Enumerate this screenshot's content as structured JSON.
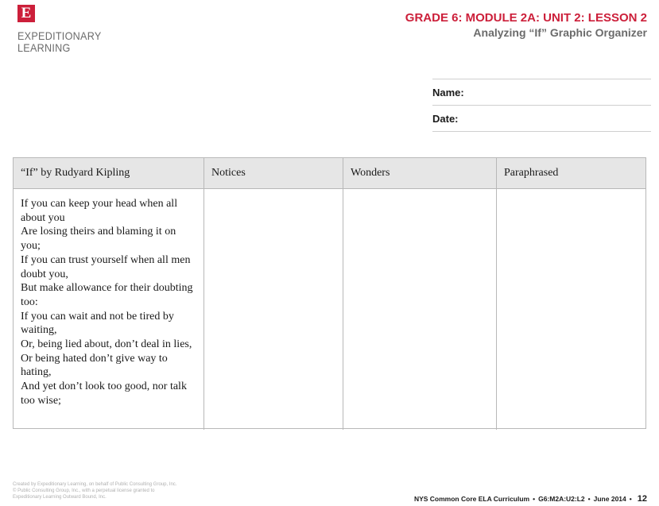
{
  "logo": {
    "mark": "E",
    "line1": "EXPEDITIONARY",
    "line2": "LEARNING"
  },
  "header": {
    "title": "GRADE 6: MODULE 2A: UNIT 2: LESSON 2",
    "subtitle": "Analyzing “If” Graphic Organizer"
  },
  "form": {
    "name_label": "Name:",
    "date_label": "Date:"
  },
  "table": {
    "headers": [
      "“If” by Rudyard Kipling",
      "Notices",
      "Wonders",
      "Paraphrased"
    ],
    "poem_lines": [
      "If you can keep your head when all about you",
      "Are losing theirs and blaming it on you;",
      "If you can trust yourself when all men doubt you,",
      "But make allowance for their doubting too:",
      "If you can wait and not be tired by waiting,",
      "Or, being lied about, don’t deal in lies,",
      "Or being hated don’t give way to hating,",
      "And yet don’t look too good, nor talk too wise;"
    ]
  },
  "footer": {
    "credit1": "Created by Expeditionary Learning, on behalf of Public Consulting Group, Inc.",
    "credit2": "© Public Consulting Group, Inc., with a perpetual license granted to",
    "credit3": "Expeditionary Learning Outward Bound, Inc.",
    "curriculum": "NYS Common Core ELA Curriculum",
    "code": "G6:M2A:U2:L2",
    "date": "June 2014",
    "page": "12"
  },
  "colors": {
    "brand_red": "#cc1f3a",
    "header_gray": "#6b6b6b",
    "table_header_bg": "#e6e6e6"
  }
}
